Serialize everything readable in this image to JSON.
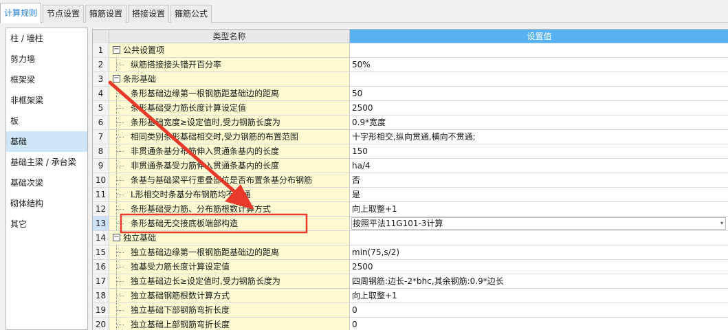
{
  "tabs": [
    {
      "label": "计算规则",
      "active": true
    },
    {
      "label": "节点设置",
      "active": false
    },
    {
      "label": "箍筋设置",
      "active": false
    },
    {
      "label": "搭接设置",
      "active": false
    },
    {
      "label": "箍筋公式",
      "active": false
    }
  ],
  "sidebar": {
    "items": [
      {
        "label": "柱 / 墙柱"
      },
      {
        "label": "剪力墙"
      },
      {
        "label": "框架梁"
      },
      {
        "label": "非框架梁"
      },
      {
        "label": "板"
      },
      {
        "label": "基础",
        "selected": true
      },
      {
        "label": "基础主梁 / 承台梁"
      },
      {
        "label": "基础次梁"
      },
      {
        "label": "砌体结构"
      },
      {
        "label": "其它"
      }
    ]
  },
  "grid": {
    "col_name_header": "类型名称",
    "col_value_header": "设置值",
    "rows": [
      {
        "num": "1",
        "name": "公共设置项",
        "value": "",
        "group": true
      },
      {
        "num": "2",
        "name": "纵筋搭接接头错开百分率",
        "value": "50%"
      },
      {
        "num": "3",
        "name": "条形基础",
        "value": "",
        "group": true
      },
      {
        "num": "4",
        "name": "条形基础边缘第一根钢筋距基础边的距离",
        "value": "50"
      },
      {
        "num": "5",
        "name": "条形基础受力筋长度计算设定值",
        "value": "2500"
      },
      {
        "num": "6",
        "name": "条形基础宽度≥设定值时,受力钢筋长度为",
        "value": "0.9*宽度"
      },
      {
        "num": "7",
        "name": "相同类别条形基础相交时,受力钢筋的布置范围",
        "value": "十字形相交,纵向贯通,横向不贯通;"
      },
      {
        "num": "8",
        "name": "非贯通条基分布筋伸入贯通条基内的长度",
        "value": "150"
      },
      {
        "num": "9",
        "name": "非贯通条基受力筋伸入贯通条基内的长度",
        "value": "ha/4"
      },
      {
        "num": "10",
        "name": "条基与基础梁平行重叠部位是否布置条基分布钢筋",
        "value": "否"
      },
      {
        "num": "11",
        "name": "L形相交时条基分布钢筋均不贯通",
        "value": "是"
      },
      {
        "num": "12",
        "name": "条形基础受力筋、分布筋根数计算方式",
        "value": "向上取整+1"
      },
      {
        "num": "13",
        "name": "条形基础无交接底板端部构造",
        "value": "按照平法11G101-3计算",
        "selected": true
      },
      {
        "num": "14",
        "name": "独立基础",
        "value": "",
        "group": true
      },
      {
        "num": "15",
        "name": "独立基础边缘第一根钢筋距基础边的距离",
        "value": "min(75,s/2)"
      },
      {
        "num": "16",
        "name": "独基受力筋长度计算设定值",
        "value": "2500"
      },
      {
        "num": "17",
        "name": "独立基础边长≥设定值时,受力钢筋长度为",
        "value": "四周钢筋:边长-2*bhc,其余钢筋:0.9*边长"
      },
      {
        "num": "18",
        "name": "独立基础钢筋根数计算方式",
        "value": "向上取整+1"
      },
      {
        "num": "19",
        "name": "独立基础下部钢筋弯折长度",
        "value": "0"
      },
      {
        "num": "20",
        "name": "独立基础上部钢筋弯折长度",
        "value": "0"
      }
    ]
  },
  "annotation": {
    "color": "#e8392b",
    "icon": "red-arrow-icon"
  },
  "tree": {
    "collapse_symbol": "−",
    "dropdown_symbol": "▾"
  }
}
